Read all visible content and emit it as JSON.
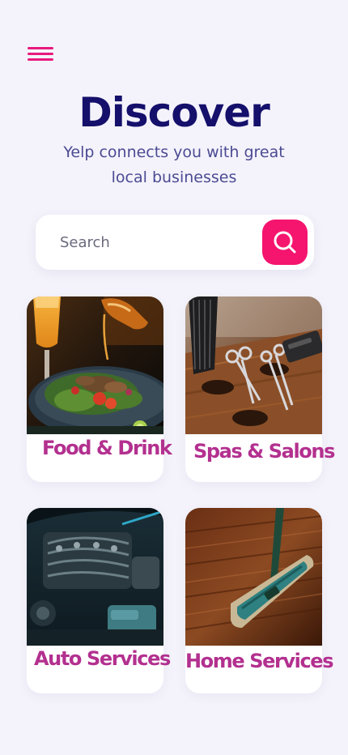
{
  "header": {
    "title": "Discover",
    "subtitle": "Yelp connects you with great local businesses",
    "menu_icon": "hamburger-menu-icon"
  },
  "search": {
    "placeholder": "Search",
    "value": "",
    "button_icon": "search-icon"
  },
  "colors": {
    "accent": "#f5156f",
    "title": "#15106b",
    "subtitle": "#4b4a93",
    "card_label": "#b3308f",
    "background": "#f4f3fb"
  },
  "categories": [
    {
      "label": "Food & Drink",
      "image": "food-drink-image"
    },
    {
      "label": "Spas & Salons",
      "image": "spas-salons-image"
    },
    {
      "label": "Auto Services",
      "image": "auto-services-image"
    },
    {
      "label": "Home Services",
      "image": "home-services-image"
    }
  ]
}
